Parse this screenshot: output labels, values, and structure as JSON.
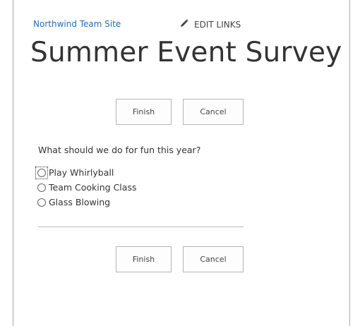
{
  "header": {
    "site_link": "Northwind Team Site",
    "edit_links": "EDIT LINKS",
    "page_title": "Summer Event Survey"
  },
  "top_buttons": {
    "finish": "Finish",
    "cancel": "Cancel"
  },
  "survey": {
    "question": "What should we do for fun this year?",
    "options": [
      {
        "label": "Play Whirlyball",
        "selected": false,
        "focused": true
      },
      {
        "label": "Team Cooking Class",
        "selected": false,
        "focused": false
      },
      {
        "label": "Glass Blowing",
        "selected": false,
        "focused": false
      }
    ]
  },
  "bottom_buttons": {
    "finish": "Finish",
    "cancel": "Cancel"
  },
  "colors": {
    "link": "#1f6fb8",
    "text": "#333333",
    "border": "#b5b5b5"
  },
  "icons": {
    "edit": "pencil-icon"
  }
}
